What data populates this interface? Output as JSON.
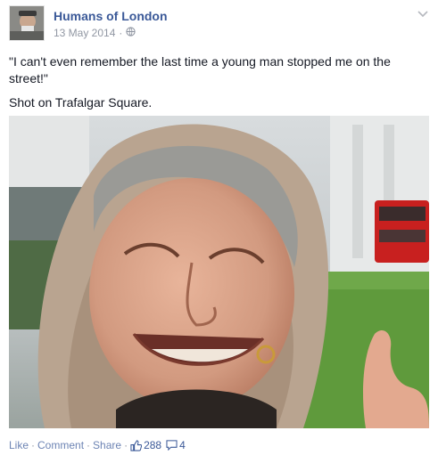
{
  "post": {
    "author": "Humans of London",
    "date": "13 May 2014",
    "meta_separator": "·",
    "privacy_icon": "globe-icon",
    "options_icon": "chevron-down-icon",
    "text_lines": [
      "\"I can't even remember the last time a young man stopped me on the street!\"",
      "Shot on Trafalgar Square."
    ]
  },
  "actions": {
    "like": "Like",
    "comment": "Comment",
    "share": "Share",
    "separator": "·",
    "likes_count": "288",
    "comments_count": "4",
    "like_icon": "thumbs-up-icon",
    "comment_icon": "comment-bubble-icon"
  },
  "colors": {
    "link": "#3b5998",
    "muted": "#9197a3",
    "action_link": "#6d84b4",
    "text": "#141823"
  }
}
